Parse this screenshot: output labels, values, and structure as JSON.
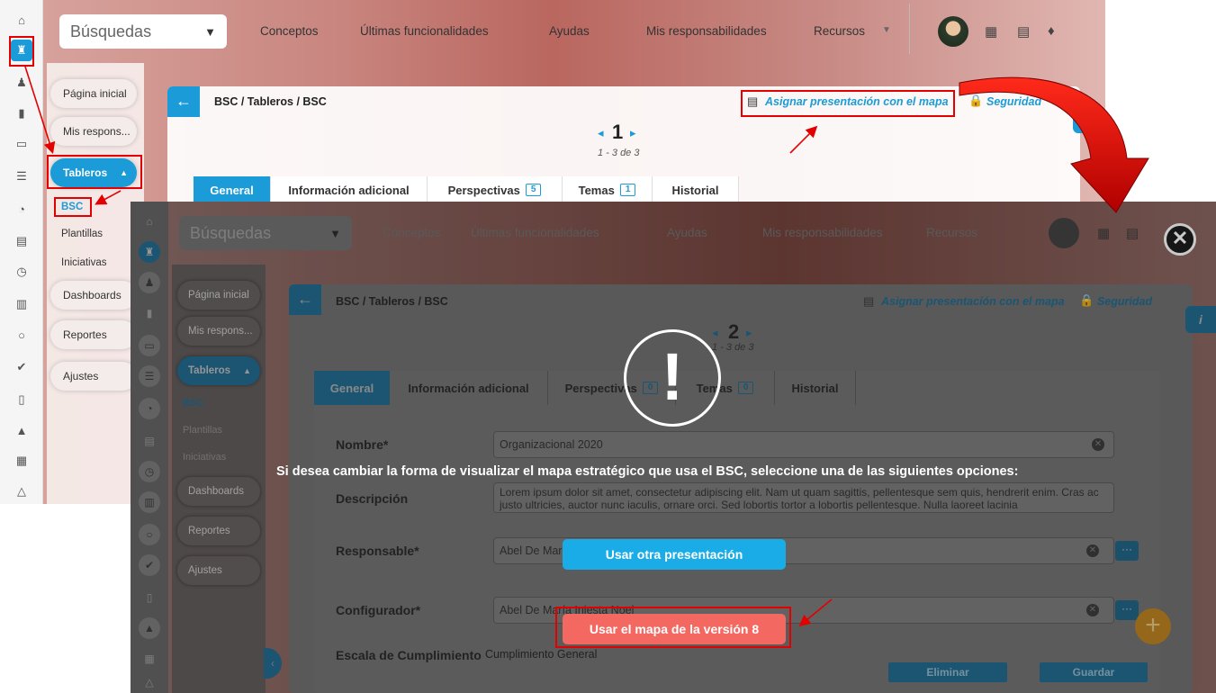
{
  "back": {
    "search_label": "Búsquedas",
    "topnav": [
      "Conceptos",
      "Últimas funcionalidades",
      "Ayudas",
      "Mis responsabilidades",
      "Recursos"
    ],
    "nav": {
      "home": "Página inicial",
      "resp": "Mis respons...",
      "tableros": "Tableros",
      "bsc": "BSC",
      "plantillas": "Plantillas",
      "iniciativas": "Iniciativas",
      "dashboards": "Dashboards",
      "reportes": "Reportes",
      "ajustes": "Ajustes"
    },
    "breadcrumb": "BSC / Tableros / BSC",
    "assign_link": "Asignar presentación con el mapa",
    "security_link": "Seguridad",
    "page_num": "1",
    "page_range": "1 - 3 de 3",
    "tabs": [
      {
        "label": "General",
        "count": ""
      },
      {
        "label": "Información adicional",
        "count": ""
      },
      {
        "label": "Perspectivas",
        "count": "5"
      },
      {
        "label": "Temas",
        "count": "1"
      },
      {
        "label": "Historial",
        "count": ""
      }
    ]
  },
  "front": {
    "search_label": "Búsquedas",
    "topnav": [
      "Conceptos",
      "Últimas funcionalidades",
      "Ayudas",
      "Mis responsabilidades",
      "Recursos"
    ],
    "nav": {
      "home": "Página inicial",
      "resp": "Mis respons...",
      "tableros": "Tableros",
      "bsc": "BSC",
      "plantillas": "Plantillas",
      "iniciativas": "Iniciativas",
      "dashboards": "Dashboards",
      "reportes": "Reportes",
      "ajustes": "Ajustes"
    },
    "breadcrumb": "BSC / Tableros / BSC",
    "assign_link": "Asignar presentación con el mapa",
    "security_link": "Seguridad",
    "page_num": "2",
    "page_range": "1 - 3 de 3",
    "tabs": [
      {
        "label": "General",
        "count": ""
      },
      {
        "label": "Información adicional",
        "count": ""
      },
      {
        "label": "Perspectivas",
        "count": "0"
      },
      {
        "label": "Temas",
        "count": "0"
      },
      {
        "label": "Historial",
        "count": ""
      }
    ],
    "form": {
      "nombre_label": "Nombre*",
      "nombre_value": "Organizacional 2020",
      "descripcion_label": "Descripción",
      "descripcion_value": "Lorem ipsum dolor sit amet, consectetur adipiscing elit. Nam ut quam sagittis, pellentesque sem quis, hendrerit enim. Cras ac justo ultricies, auctor nunc iaculis, ornare orci. Sed lobortis tortor a lobortis pellentesque. Nulla laoreet lacinia",
      "responsable_label": "Responsable*",
      "responsable_value": "Abel De María Iniesta Noel",
      "configurador_label": "Configurador*",
      "configurador_value": "Abel De María Iniesta Noel",
      "escala_label": "Escala de Cumplimiento",
      "escala_value": "Cumplimiento General",
      "eliminar": "Eliminar",
      "guardar": "Guardar"
    },
    "dialog": {
      "message": "Si desea cambiar la forma de visualizar el mapa estratégico que usa el BSC, seleccione una de las siguientes opciones:",
      "option_other": "Usar otra presentación",
      "option_v8": "Usar el mapa de la versión 8"
    }
  },
  "colors": {
    "accent_blue": "#1b9bd7",
    "annotation_red": "#e30000",
    "option_red": "#f36961"
  }
}
